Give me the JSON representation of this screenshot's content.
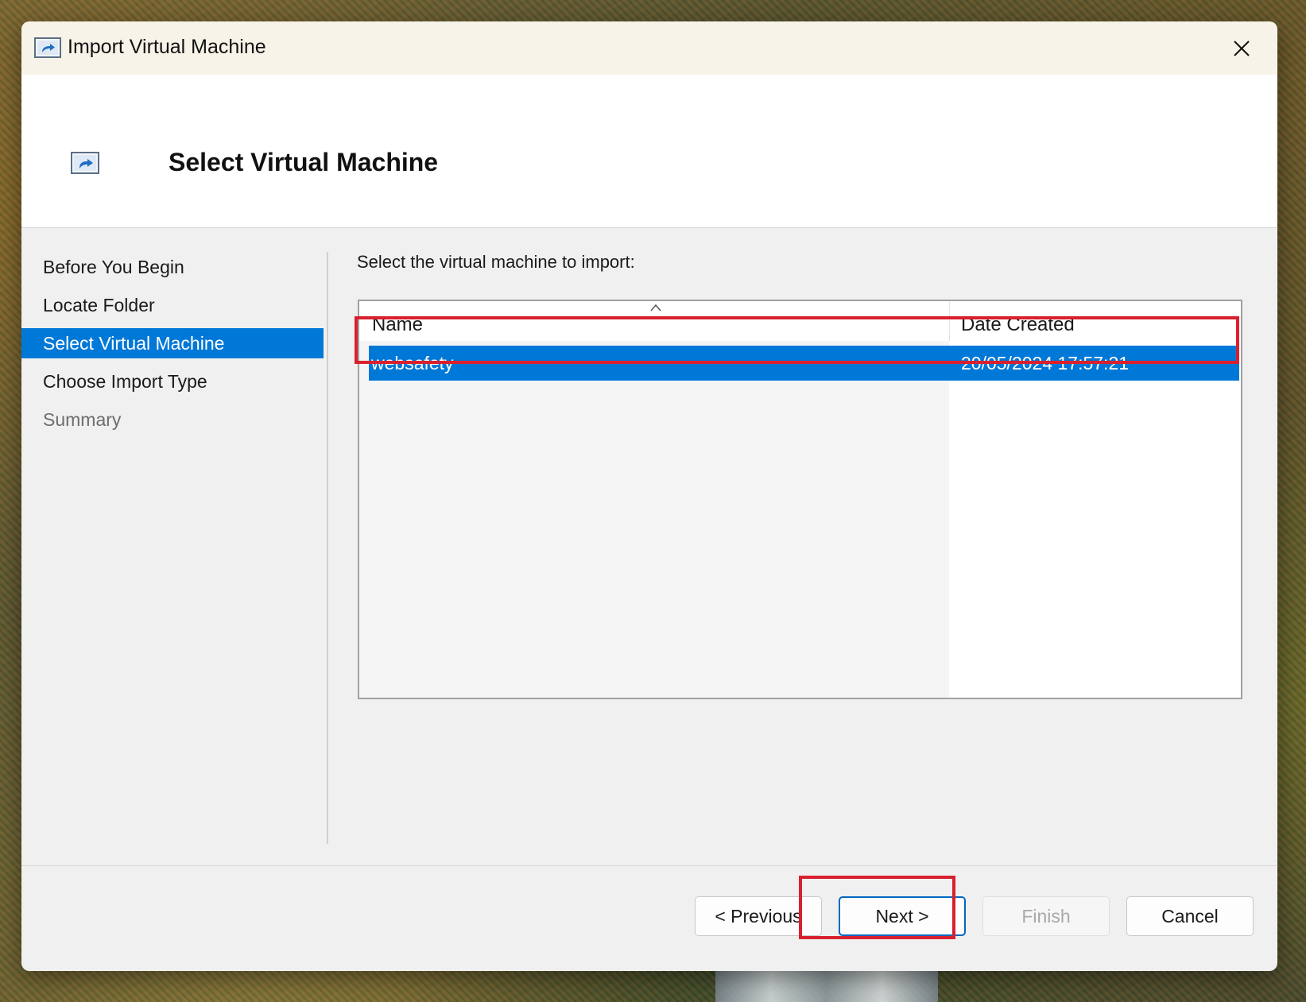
{
  "window": {
    "title": "Import Virtual Machine",
    "icon": "import-vm-icon"
  },
  "header": {
    "title": "Select Virtual Machine",
    "icon": "import-vm-icon"
  },
  "nav": {
    "items": [
      {
        "label": "Before You Begin",
        "state": "normal"
      },
      {
        "label": "Locate Folder",
        "state": "normal"
      },
      {
        "label": "Select Virtual Machine",
        "state": "active"
      },
      {
        "label": "Choose Import Type",
        "state": "normal"
      },
      {
        "label": "Summary",
        "state": "disabled"
      }
    ]
  },
  "main": {
    "prompt": "Select the virtual machine to import:",
    "columns": [
      "Name",
      "Date Created"
    ],
    "rows": [
      {
        "name": "websafety",
        "date_created": "20/05/2024 17:57:21",
        "selected": true
      }
    ]
  },
  "buttons": {
    "previous": "< Previous",
    "next": "Next >",
    "finish": "Finish",
    "cancel": "Cancel"
  },
  "colors": {
    "accent": "#0078d7",
    "highlight_box": "#d9202e"
  }
}
